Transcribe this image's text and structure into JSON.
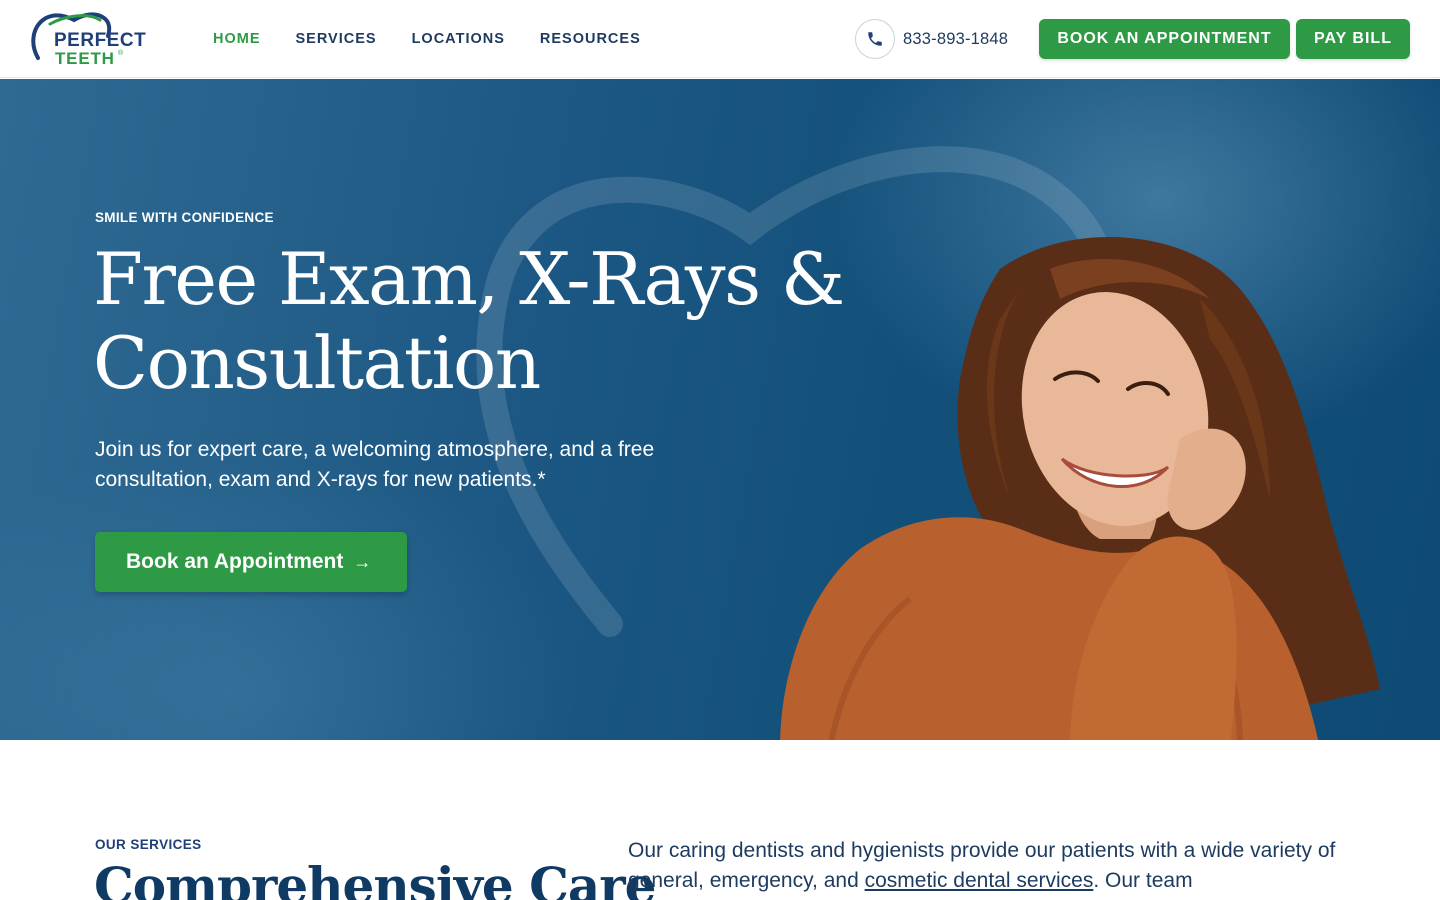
{
  "header": {
    "logo": {
      "line1": "PERFECT",
      "line2": "TEETH",
      "tm": "®"
    },
    "nav": [
      {
        "label": "HOME",
        "active": true
      },
      {
        "label": "SERVICES",
        "active": false
      },
      {
        "label": "LOCATIONS",
        "active": false
      },
      {
        "label": "RESOURCES",
        "active": false
      }
    ],
    "phone": "833-893-1848",
    "book_label": "BOOK AN APPOINTMENT",
    "pay_label": "PAY BILL"
  },
  "hero": {
    "eyebrow": "SMILE WITH CONFIDENCE",
    "title_line1": "Free Exam, X-Rays &",
    "title_line2": "Consultation",
    "subtitle": "Join us for expert care, a welcoming atmosphere, and a free consultation, exam and X-rays for new patients.*",
    "cta_label": "Book an Appointment",
    "cta_icon": "arrow-right-icon"
  },
  "services": {
    "eyebrow": "OUR SERVICES",
    "title": "Comprehensive Care",
    "text_before": "Our caring dentists and hygienists provide our patients with a wide variety of general, emergency, and ",
    "link_text": "cosmetic dental services",
    "text_after": ". Our team"
  },
  "colors": {
    "brand_green": "#2e9a45",
    "brand_navy": "#1e3f78",
    "hero_blue": "#1c5783"
  }
}
